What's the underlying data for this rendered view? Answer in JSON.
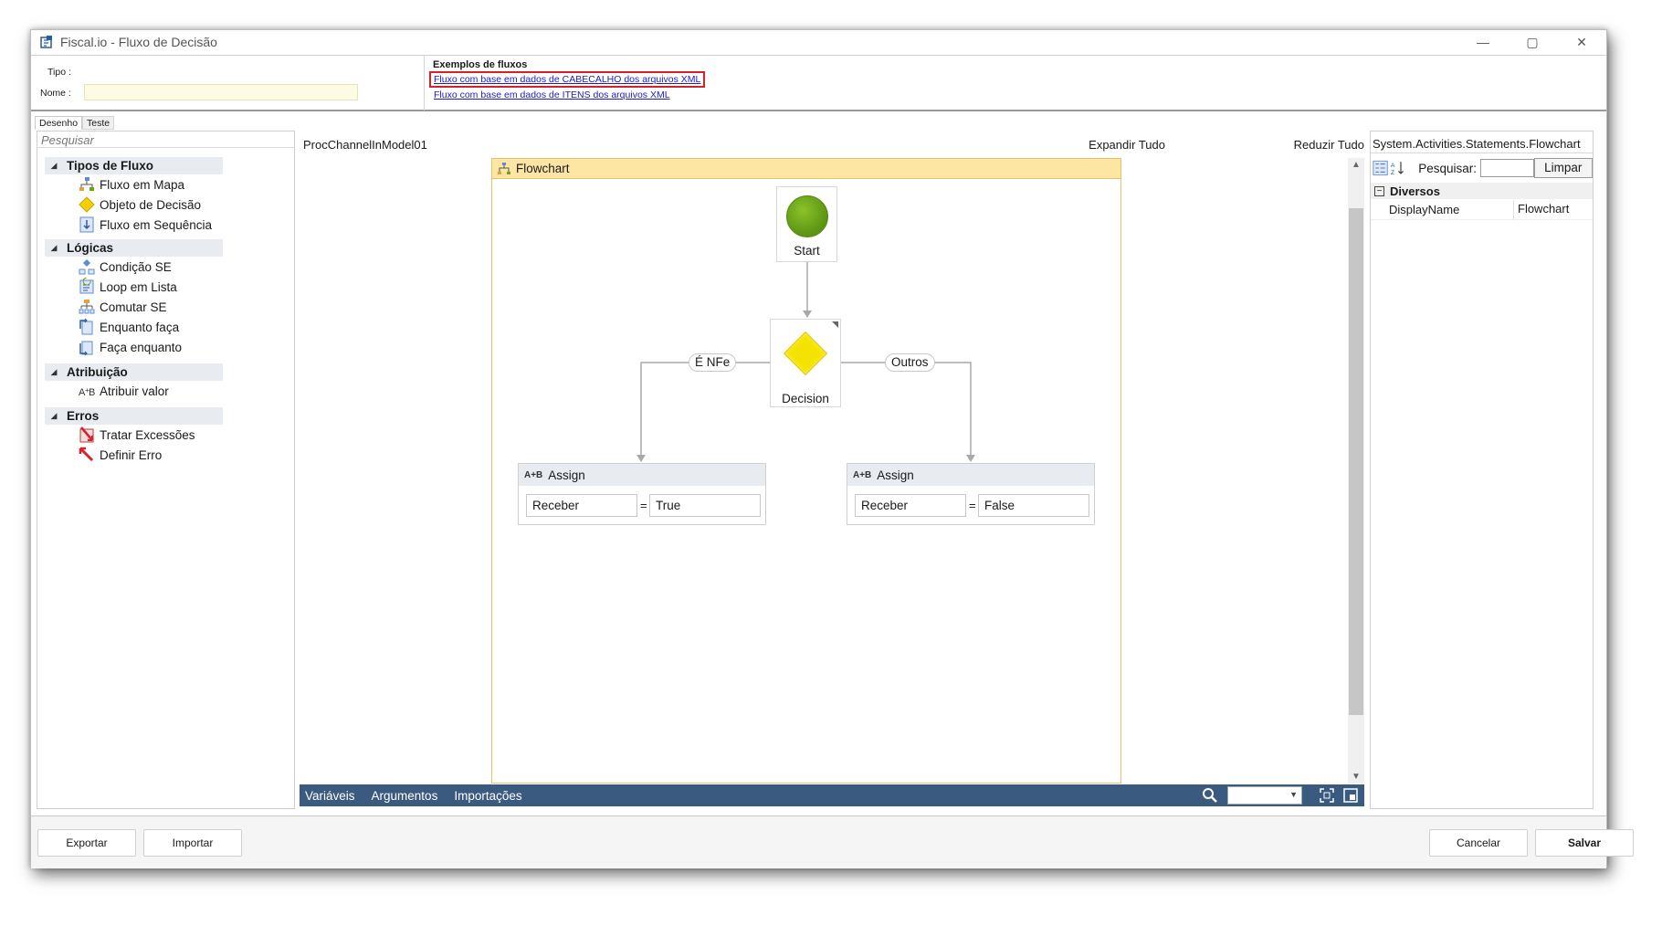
{
  "window": {
    "title": "Fiscal.io - Fluxo de Decisão",
    "buttons": [
      "—",
      "▢",
      "✕"
    ]
  },
  "header": {
    "tipo_label": "Tipo :",
    "nome_label": "Nome :",
    "nome_value": "",
    "examples_title": "Exemplos de fluxos",
    "example_link_1": "Fluxo com base em dados de CABECALHO dos arquivos XML",
    "example_link_2": "Fluxo com base em dados de ITENS dos arquivos XML"
  },
  "tabs": {
    "design": "Desenho",
    "test": "Teste"
  },
  "toolbox": {
    "search_placeholder": "Pesquisar",
    "categories": [
      {
        "label": "Tipos de Fluxo",
        "items": [
          "Fluxo em Mapa",
          "Objeto de Decisão",
          "Fluxo em Sequência"
        ]
      },
      {
        "label": "Lógicas",
        "items": [
          "Condição SE",
          "Loop em Lista",
          "Comutar SE",
          "Enquanto faça",
          "Faça enquanto"
        ]
      },
      {
        "label": "Atribuição",
        "items": [
          "Atribuir valor"
        ]
      },
      {
        "label": "Erros",
        "items": [
          "Tratar Excessões",
          "Definir Erro"
        ]
      }
    ]
  },
  "designer": {
    "breadcrumb": "ProcChannelInModel01",
    "expand_all": "Expandir Tudo",
    "collapse_all": "Reduzir Tudo",
    "flowchart_title": "Flowchart",
    "start_label": "Start",
    "decision_label": "Decision",
    "branch_true": "É NFe",
    "branch_false": "Outros",
    "assign_left": {
      "title": "Assign",
      "to": "Receber",
      "value": "True"
    },
    "assign_right": {
      "title": "Assign",
      "to": "Receber",
      "value": "False"
    },
    "bottom_tabs": [
      "Variáveis",
      "Argumentos",
      "Importações"
    ]
  },
  "properties": {
    "title": "System.Activities.Statements.Flowchart",
    "search_label": "Pesquisar:",
    "clear_button": "Limpar",
    "category": "Diversos",
    "rows": [
      {
        "name": "DisplayName",
        "value": "Flowchart"
      }
    ]
  },
  "footer": {
    "export": "Exportar",
    "import": "Importar",
    "cancel": "Cancelar",
    "save": "Salvar"
  },
  "colors": {
    "accent_bar": "#3b5a80",
    "flowchart_header": "#fde6a4",
    "start_green": "#6aa516",
    "decision_yellow": "#f4e300",
    "highlight_red": "#d8202a"
  }
}
